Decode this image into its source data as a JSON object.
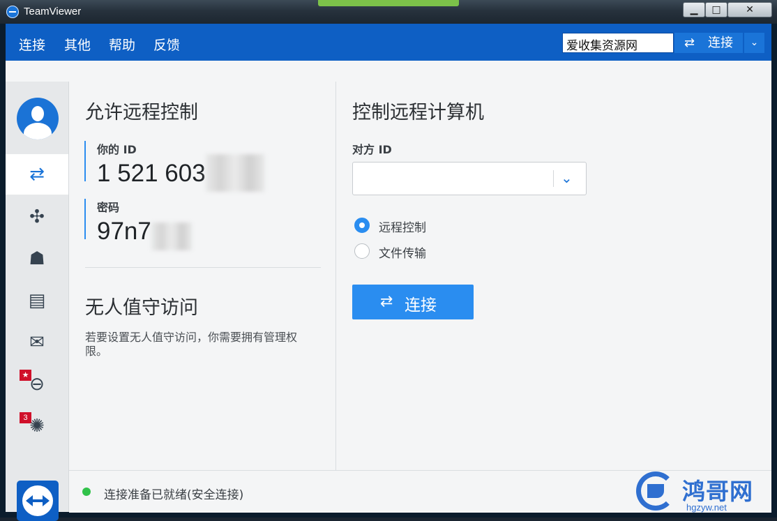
{
  "window": {
    "title": "TeamViewer",
    "controls": {
      "minimize": "▁",
      "maximize": "□",
      "close": "✕"
    }
  },
  "menu": {
    "items": [
      "连接",
      "其他",
      "帮助",
      "反馈"
    ]
  },
  "quick_connect": {
    "input_value": "爱收集资源网",
    "button_label": "连接",
    "arrows_icon": "⇄",
    "dropdown_icon": "⌄"
  },
  "allow_remote": {
    "title": "允许远程控制",
    "your_id_label": "你的 ID",
    "your_id_value": "1 521 603",
    "password_label": "密码",
    "password_value": "97n7"
  },
  "unattended": {
    "title": "无人值守访问",
    "hint": "若要设置无人值守访问，你需要拥有管理权限。"
  },
  "control_remote": {
    "title": "控制远程计算机",
    "partner_id_label": "对方 ID",
    "partner_id_value": "",
    "options": [
      {
        "label": "远程控制",
        "selected": true
      },
      {
        "label": "文件传输",
        "selected": false
      }
    ],
    "connect_label": "连接",
    "connect_icon": "⇄"
  },
  "sidebar": {
    "icons": [
      "avatar-icon",
      "remote-control-icon",
      "meeting-icon",
      "group-icon",
      "contacts-icon",
      "chat-icon",
      "augmented-reality-icon",
      "ideas-icon",
      "teamviewer-logo-icon"
    ],
    "badges": {
      "ar": "★",
      "ideas": "3"
    }
  },
  "status": {
    "text": "连接准备已就绪(安全连接)",
    "color": "#31c24a"
  },
  "watermark": {
    "brand": "鸿哥网",
    "url": "hgzyw.net"
  },
  "colors": {
    "accent": "#0e5fc4",
    "button": "#2a8df0"
  }
}
